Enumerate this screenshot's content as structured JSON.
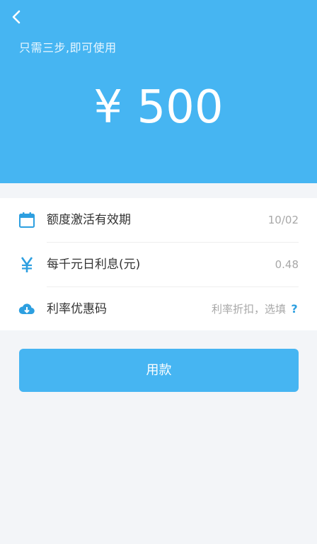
{
  "header": {
    "subtitle": "只需三步,即可使用",
    "amount": "¥ 500"
  },
  "details": {
    "rows": [
      {
        "icon": "calendar-icon",
        "label": "额度激活有效期",
        "value": "10/02"
      },
      {
        "icon": "yen-icon",
        "label": "每千元日利息(元)",
        "value": "0.48"
      },
      {
        "icon": "cloud-download-icon",
        "label": "利率优惠码",
        "value": "利率折扣，选填",
        "help": "?"
      }
    ]
  },
  "action": {
    "button_label": "用款"
  },
  "colors": {
    "accent": "#46b5f2",
    "help": "#2d9fe0",
    "muted": "#a8a8a8"
  }
}
